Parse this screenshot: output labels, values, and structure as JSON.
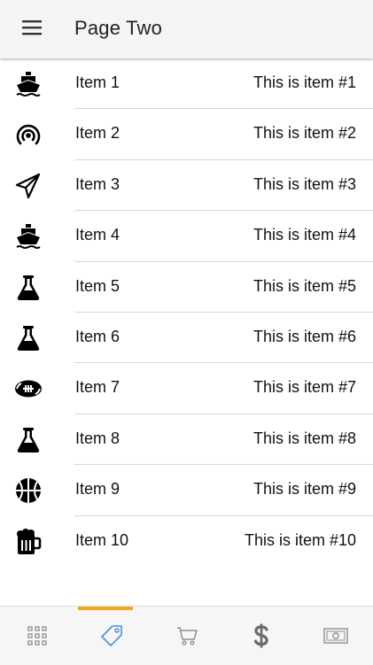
{
  "appbar": {
    "title": "Page Two",
    "menu_icon": "menu-icon"
  },
  "list": {
    "items": [
      {
        "title": "Item 1",
        "subtitle": "This is item #1",
        "icon": "ship-icon"
      },
      {
        "title": "Item 2",
        "subtitle": "This is item #2",
        "icon": "broadcast-icon"
      },
      {
        "title": "Item 3",
        "subtitle": "This is item #3",
        "icon": "paper-plane-icon"
      },
      {
        "title": "Item 4",
        "subtitle": "This is item #4",
        "icon": "ship-icon"
      },
      {
        "title": "Item 5",
        "subtitle": "This is item #5",
        "icon": "flask-icon"
      },
      {
        "title": "Item 6",
        "subtitle": "This is item #6",
        "icon": "flask-icon"
      },
      {
        "title": "Item 7",
        "subtitle": "This is item #7",
        "icon": "football-icon"
      },
      {
        "title": "Item 8",
        "subtitle": "This is item #8",
        "icon": "flask-icon"
      },
      {
        "title": "Item 9",
        "subtitle": "This is item #9",
        "icon": "basketball-icon"
      },
      {
        "title": "Item 10",
        "subtitle": "This is item #10",
        "icon": "beer-mug-icon"
      }
    ]
  },
  "bottom_nav": {
    "tabs": [
      {
        "icon": "apps-grid-icon",
        "active": false
      },
      {
        "icon": "price-tag-icon",
        "active": true
      },
      {
        "icon": "shopping-cart-icon",
        "active": false
      },
      {
        "icon": "dollar-icon",
        "active": false
      },
      {
        "icon": "banknote-icon",
        "active": false
      }
    ]
  },
  "colors": {
    "appbar_bg": "#f5f5f5",
    "active_tab_icon": "#4a90e2",
    "active_tab_indicator": "#f5a623",
    "inactive_tab_icon": "#8e8e8e",
    "divider": "#d7d7d7"
  }
}
